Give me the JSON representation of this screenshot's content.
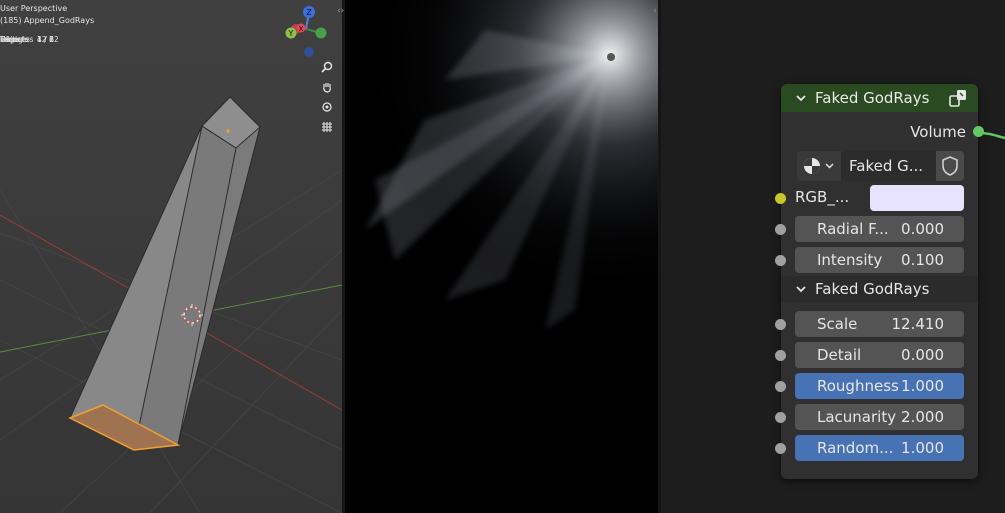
{
  "viewport": {
    "title": "User Perspective",
    "object_name": "(185) Append_GodRays",
    "stats": [
      {
        "label": "Objects",
        "value": "1 / 2"
      },
      {
        "label": "Vertices",
        "value": "4 / 8"
      },
      {
        "label": "Edges",
        "value": "4 / 12"
      },
      {
        "label": "Faces",
        "value": "1 / 6"
      },
      {
        "label": "Triangles",
        "value": "12"
      }
    ],
    "gizmo": {
      "x": "X",
      "y": "Y",
      "z": "Z"
    },
    "nav_icons": [
      "zoom-icon",
      "hand-pan-icon",
      "camera-orbit-icon",
      "grid-view-icon"
    ]
  },
  "node": {
    "title": "Faked GodRays",
    "output_label": "Volume",
    "datablock_name": "Faked G...",
    "rgb_label": "RGB_...",
    "inputs": [
      {
        "label": "Radial F...",
        "value": "0.000",
        "highlight": false
      },
      {
        "label": "Intensity",
        "value": "0.100",
        "highlight": false
      }
    ],
    "panel_title": "Faked GodRays",
    "panel_inputs": [
      {
        "label": "Scale",
        "value": "12.410",
        "highlight": false
      },
      {
        "label": "Detail",
        "value": "0.000",
        "highlight": false
      },
      {
        "label": "Roughness",
        "value": "1.000",
        "highlight": true
      },
      {
        "label": "Lacunarity",
        "value": "2.000",
        "highlight": false
      },
      {
        "label": "Random...",
        "value": "1.000",
        "highlight": true
      }
    ],
    "colors": {
      "header": "#2a4a21",
      "highlight": "#4772b3",
      "rgb": "#e7e3ff",
      "volume_socket": "#63c763",
      "color_socket": "#c7c729"
    }
  }
}
